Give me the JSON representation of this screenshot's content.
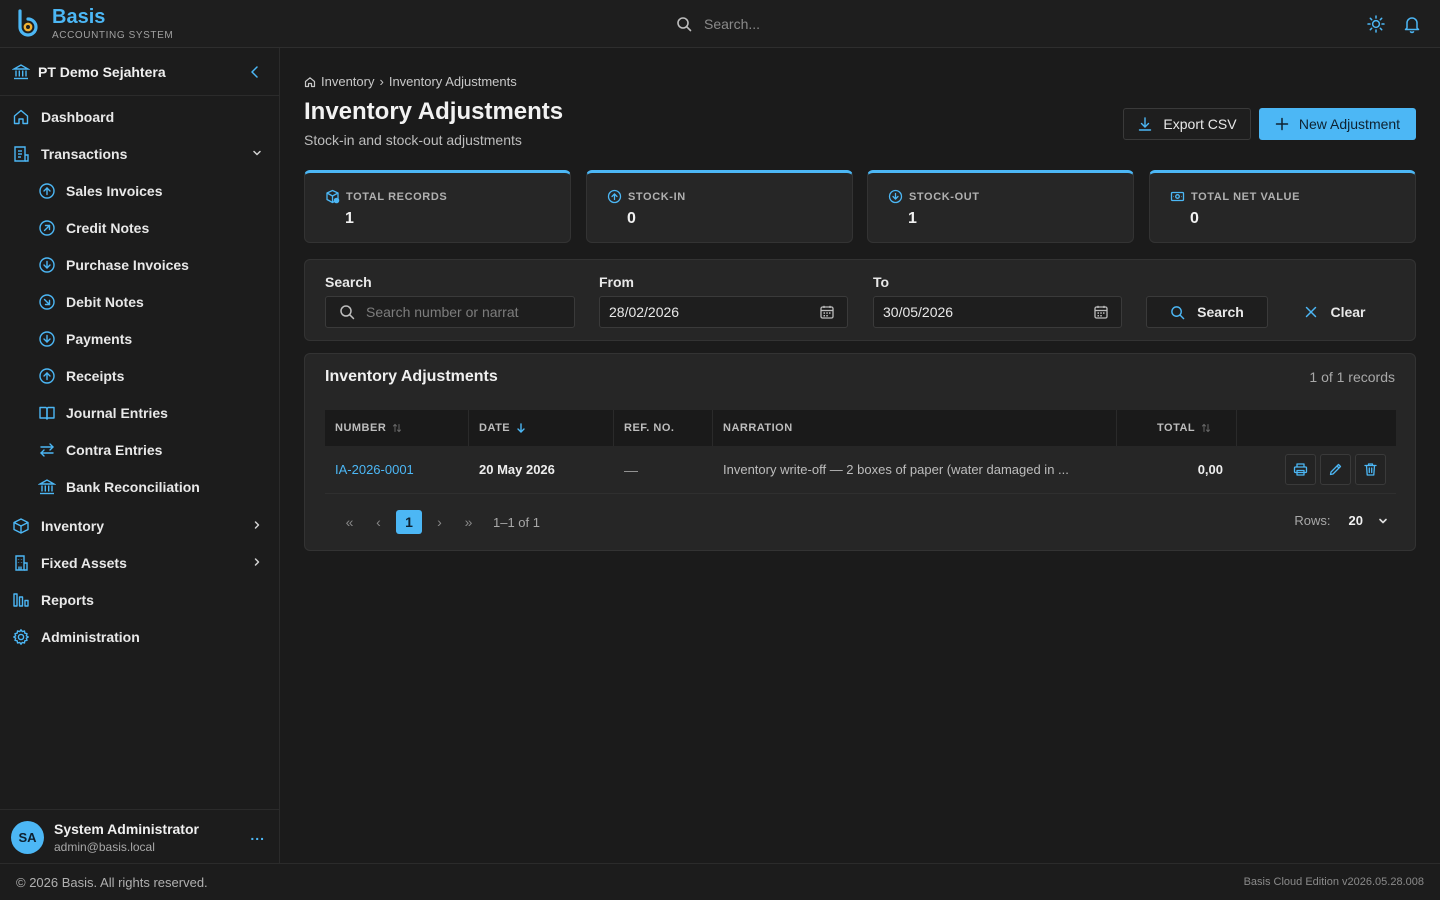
{
  "app": {
    "name": "Basis",
    "subtitle": "ACCOUNTING SYSTEM"
  },
  "topbar": {
    "search_placeholder": "Search..."
  },
  "sidebar": {
    "company": "PT Demo Sejahtera",
    "items": [
      {
        "label": "Dashboard"
      },
      {
        "label": "Transactions"
      },
      {
        "label": "Sales Invoices"
      },
      {
        "label": "Credit Notes"
      },
      {
        "label": "Purchase Invoices"
      },
      {
        "label": "Debit Notes"
      },
      {
        "label": "Payments"
      },
      {
        "label": "Receipts"
      },
      {
        "label": "Journal Entries"
      },
      {
        "label": "Contra Entries"
      },
      {
        "label": "Bank Reconciliation"
      },
      {
        "label": "Inventory"
      },
      {
        "label": "Fixed Assets"
      },
      {
        "label": "Reports"
      },
      {
        "label": "Administration"
      }
    ],
    "user": {
      "initials": "SA",
      "name": "System Administrator",
      "email": "admin@basis.local",
      "more": "..."
    }
  },
  "breadcrumb": {
    "parent": "Inventory",
    "sep": "›",
    "current": "Inventory Adjustments"
  },
  "page": {
    "title": "Inventory Adjustments",
    "subtitle": "Stock-in and stock-out adjustments",
    "export_label": "Export CSV",
    "new_label": "New Adjustment"
  },
  "stats": [
    {
      "label": "TOTAL RECORDS",
      "value": "1"
    },
    {
      "label": "STOCK-IN",
      "value": "0"
    },
    {
      "label": "STOCK-OUT",
      "value": "1"
    },
    {
      "label": "TOTAL NET VALUE",
      "value": "0"
    }
  ],
  "filters": {
    "search_label": "Search",
    "search_placeholder": "Search number or narrat",
    "from_label": "From",
    "from_value": "28/02/2026",
    "to_label": "To",
    "to_value": "30/05/2026",
    "search_button": "Search",
    "clear_button": "Clear"
  },
  "table": {
    "title": "Inventory Adjustments",
    "count": "1 of 1 records",
    "columns": [
      "NUMBER",
      "DATE",
      "REF. NO.",
      "NARRATION",
      "TOTAL"
    ],
    "rows": [
      {
        "number": "IA-2026-0001",
        "date": "20 May 2026",
        "ref": "—",
        "narration": "Inventory write-off — 2 boxes of paper (water damaged in ...",
        "total": "0,00"
      }
    ],
    "pager": {
      "first": "«",
      "prev": "‹",
      "page": "1",
      "next": "›",
      "last": "»",
      "info": "1–1 of 1"
    },
    "rows_label": "Rows:",
    "rows_value": "20"
  },
  "footer": {
    "copyright": "© 2026 Basis. All rights reserved.",
    "version": "Basis Cloud Edition v2026.05.28.008"
  },
  "colors": {
    "accent": "#4cb7f5",
    "background": "#1b1b1b",
    "card": "#262626"
  }
}
